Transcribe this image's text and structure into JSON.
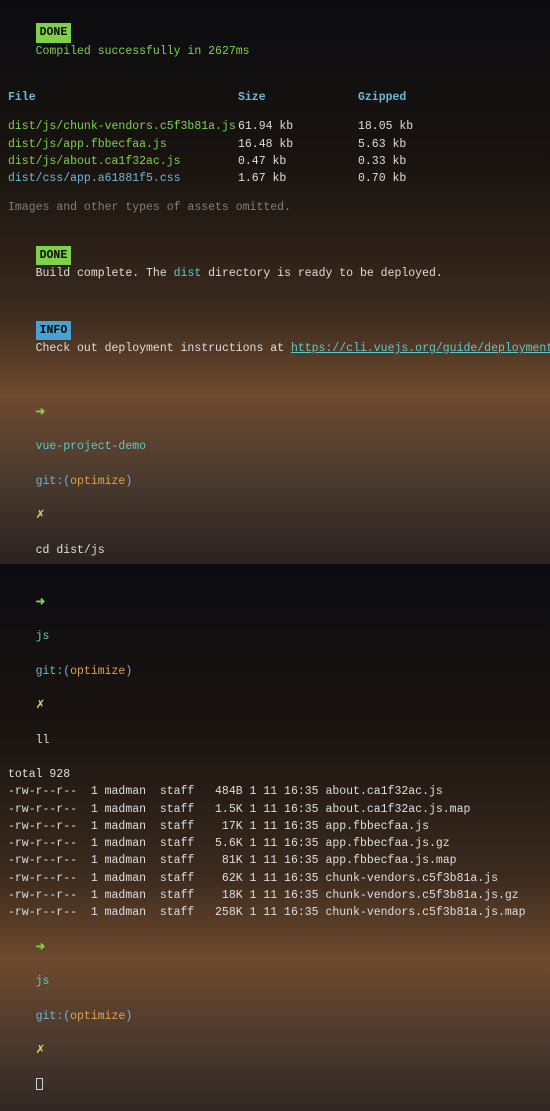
{
  "status": {
    "done_label": "DONE",
    "info_label": "INFO",
    "compiled_msg": "Compiled successfully in 2627ms"
  },
  "table": {
    "head_file": "File",
    "head_size": "Size",
    "head_gzip": "Gzipped",
    "rows": [
      {
        "file": "dist/js/chunk-vendors.c5f3b81a.js",
        "size": "61.94 kb",
        "gzip": "18.05 kb",
        "color": "green"
      },
      {
        "file": "dist/js/app.fbbecfaa.js",
        "size": "16.48 kb",
        "gzip": "5.63 kb",
        "color": "green"
      },
      {
        "file": "dist/js/about.ca1f32ac.js",
        "size": "0.47 kb",
        "gzip": "0.33 kb",
        "color": "green"
      },
      {
        "file": "dist/css/app.a61881f5.css",
        "size": "1.67 kb",
        "gzip": "0.70 kb",
        "color": "blue"
      }
    ]
  },
  "omitted": "Images and other types of assets omitted.",
  "build": {
    "prefix": "Build complete. The ",
    "dist": "dist",
    "suffix": " directory is ready to be deployed."
  },
  "info": {
    "prefix": "Check out deployment instructions at ",
    "url": "https://cli.vuejs.org/guide/deployment.html"
  },
  "prompts": {
    "arrow": "➜",
    "git_label": "git:(",
    "git_branch": "optimize",
    "git_close": ")",
    "dirty": "✗",
    "p1_dir": "vue-project-demo",
    "p1_cmd": "cd dist/js",
    "p2_dir": "js",
    "p2_cmd": "ll",
    "p3_dir": "js"
  },
  "ls": {
    "total": "total 928",
    "rows": [
      {
        "perm": "-rw-r--r--",
        "links": "1",
        "user": "madman",
        "group": "staff",
        "size": "484B",
        "date": "1 11 16:35",
        "name": "about.ca1f32ac.js"
      },
      {
        "perm": "-rw-r--r--",
        "links": "1",
        "user": "madman",
        "group": "staff",
        "size": "1.5K",
        "date": "1 11 16:35",
        "name": "about.ca1f32ac.js.map"
      },
      {
        "perm": "-rw-r--r--",
        "links": "1",
        "user": "madman",
        "group": "staff",
        "size": "17K",
        "date": "1 11 16:35",
        "name": "app.fbbecfaa.js"
      },
      {
        "perm": "-rw-r--r--",
        "links": "1",
        "user": "madman",
        "group": "staff",
        "size": "5.6K",
        "date": "1 11 16:35",
        "name": "app.fbbecfaa.js.gz"
      },
      {
        "perm": "-rw-r--r--",
        "links": "1",
        "user": "madman",
        "group": "staff",
        "size": "81K",
        "date": "1 11 16:35",
        "name": "app.fbbecfaa.js.map"
      },
      {
        "perm": "-rw-r--r--",
        "links": "1",
        "user": "madman",
        "group": "staff",
        "size": "62K",
        "date": "1 11 16:35",
        "name": "chunk-vendors.c5f3b81a.js"
      },
      {
        "perm": "-rw-r--r--",
        "links": "1",
        "user": "madman",
        "group": "staff",
        "size": "18K",
        "date": "1 11 16:35",
        "name": "chunk-vendors.c5f3b81a.js.gz"
      },
      {
        "perm": "-rw-r--r--",
        "links": "1",
        "user": "madman",
        "group": "staff",
        "size": "258K",
        "date": "1 11 16:35",
        "name": "chunk-vendors.c5f3b81a.js.map"
      }
    ]
  }
}
